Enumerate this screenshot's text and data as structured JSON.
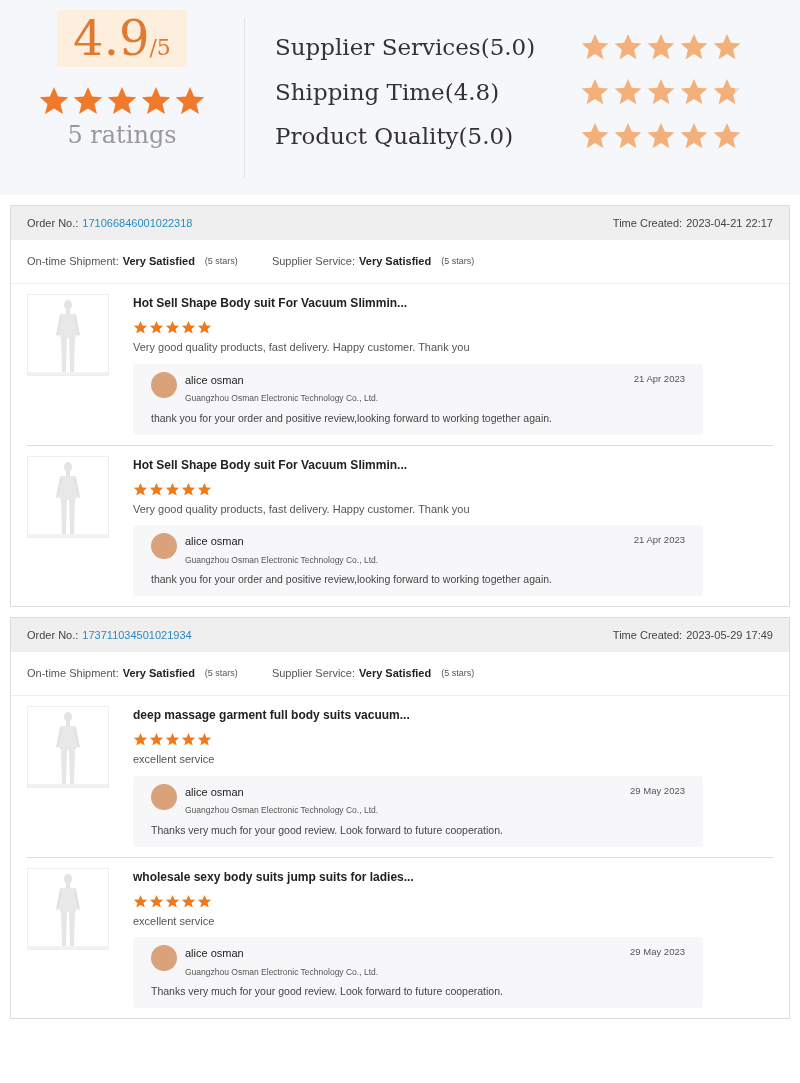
{
  "summary": {
    "score": "4.9",
    "out_of": "/5",
    "stars": 5,
    "ratings": "5 ratings",
    "categories": [
      {
        "label": "Supplier Services(5.0)",
        "stars": 5
      },
      {
        "label": "Shipping Time(4.8)",
        "stars": 4.8
      },
      {
        "label": "Product Quality(5.0)",
        "stars": 5
      }
    ]
  },
  "orders": [
    {
      "order_label": "Order No.:",
      "order_no": "171066846001022318",
      "time_label": "Time Created:",
      "time": "2023-04-21 22:17",
      "shipment_label": "On-time Shipment:",
      "shipment_value": "Very Satisfied",
      "shipment_stars": "(5 stars)",
      "service_label": "Supplier Service:",
      "service_value": "Very Satisfied",
      "service_stars": "(5 stars)",
      "items": [
        {
          "title": "Hot Sell Shape Body suit For Vacuum Slimmin...",
          "stars": 5,
          "review": "Very good quality products, fast delivery. Happy customer. Thank you",
          "reply": {
            "name": "alice osman",
            "company": "Guangzhou Osman Electronic Technology Co., Ltd.",
            "date": "21 Apr 2023",
            "text": "thank you for your order and positive review,looking forward to working together again."
          }
        },
        {
          "title": "Hot Sell Shape Body suit For Vacuum Slimmin...",
          "stars": 5,
          "review": "Very good quality products, fast delivery. Happy customer. Thank you",
          "reply": {
            "name": "alice osman",
            "company": "Guangzhou Osman Electronic Technology Co., Ltd.",
            "date": "21 Apr 2023",
            "text": "thank you for your order and positive review,looking forward to working together again."
          }
        }
      ]
    },
    {
      "order_label": "Order No.:",
      "order_no": "173711034501021934",
      "time_label": "Time Created:",
      "time": "2023-05-29 17:49",
      "shipment_label": "On-time Shipment:",
      "shipment_value": "Very Satisfied",
      "shipment_stars": "(5 stars)",
      "service_label": "Supplier Service:",
      "service_value": "Very Satisfied",
      "service_stars": "(5 stars)",
      "items": [
        {
          "title": "deep massage garment full body suits vacuum...",
          "stars": 5,
          "review": "excellent service",
          "reply": {
            "name": "alice osman",
            "company": "Guangzhou Osman Electronic Technology Co., Ltd.",
            "date": "29 May 2023",
            "text": "Thanks very much for your good review. Look forward to future cooperation."
          }
        },
        {
          "title": "wholesale sexy body suits jump suits for ladies...",
          "stars": 5,
          "review": "excellent service",
          "reply": {
            "name": "alice osman",
            "company": "Guangzhou Osman Electronic Technology Co., Ltd.",
            "date": "29 May 2023",
            "text": "Thanks very much for your good review. Look forward to future cooperation."
          }
        }
      ]
    }
  ]
}
